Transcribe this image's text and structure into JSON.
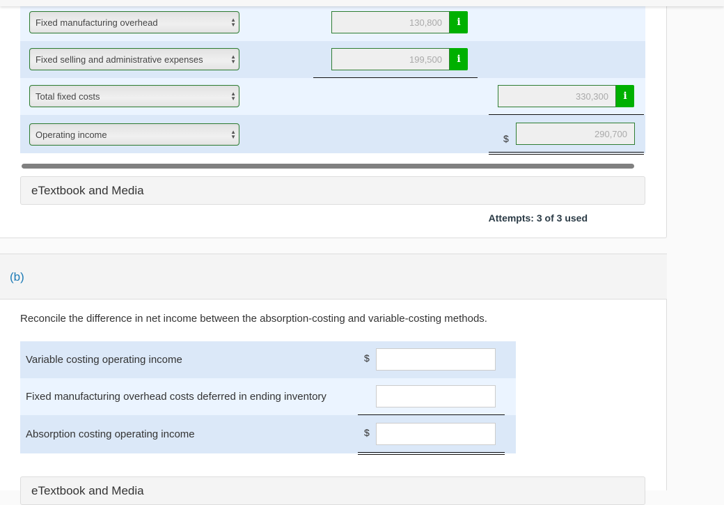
{
  "part_a": {
    "rows": [
      {
        "label": "Fixed manufacturing overhead",
        "value": "130,800",
        "info": "i"
      },
      {
        "label": "Fixed selling and administrative expenses",
        "value": "199,500",
        "info": "i"
      },
      {
        "label": "Total fixed costs",
        "value": "330,300",
        "info": "i"
      },
      {
        "label": "Operating income",
        "currency": "$",
        "value": "290,700"
      }
    ],
    "etextbook_label": "eTextbook and Media",
    "attempts": "Attempts: 3 of 3 used"
  },
  "part_b": {
    "label": "(b)",
    "instruction": "Reconcile the difference in net income between the absorption-costing and variable-costing methods.",
    "rows": [
      {
        "label": "Variable costing operating income",
        "currency": "$",
        "value": ""
      },
      {
        "label": "Fixed manufacturing overhead costs deferred in ending inventory",
        "currency": "",
        "value": ""
      },
      {
        "label": "Absorption costing operating income",
        "currency": "$",
        "value": ""
      }
    ],
    "etextbook_label": "eTextbook and Media"
  },
  "colors": {
    "accent_green": "#00b000",
    "border_green": "#2e7d32",
    "part_label_blue": "#1d7bb6",
    "row_light": "#ebf4ff",
    "row_dark": "#dbe8f8"
  }
}
